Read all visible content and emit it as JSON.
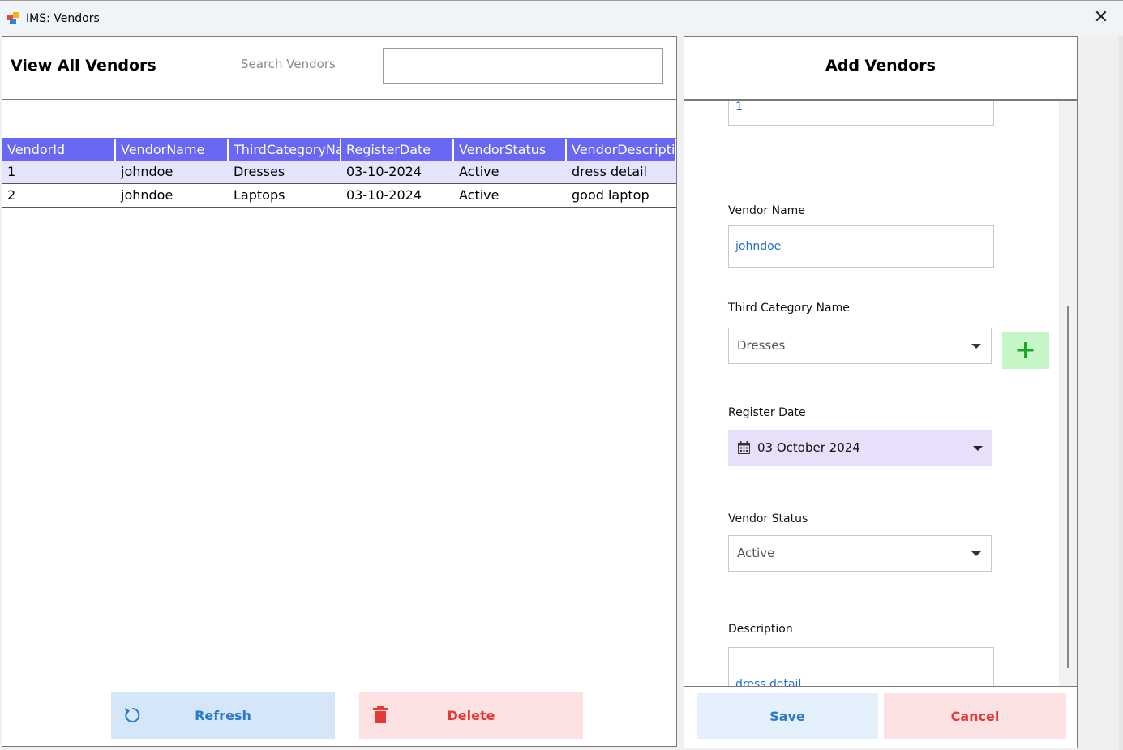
{
  "window": {
    "title": "IMS: Vendors",
    "close_glyph": "✕"
  },
  "left": {
    "title": "View All Vendors",
    "search_label": "Search Vendors",
    "search_value": ""
  },
  "grid": {
    "columns": [
      "VendorId",
      "VendorName",
      "ThirdCategoryNa",
      "RegisterDate",
      "VendorStatus",
      "VendorDescriptic"
    ],
    "rows": [
      [
        "1",
        "johndoe",
        "Dresses",
        "03-10-2024",
        "Active",
        "dress detail"
      ],
      [
        "2",
        "johndoe",
        "Laptops",
        "03-10-2024",
        "Active",
        "good laptop"
      ]
    ],
    "header_color": "#6a67f5",
    "selected_row_color": "#e6e4fc"
  },
  "buttons": {
    "refresh": {
      "label": "Refresh",
      "icon": "refresh-icon"
    },
    "delete": {
      "label": "Delete",
      "icon": "trash-icon"
    },
    "save": {
      "label": "Save"
    },
    "cancel": {
      "label": "Cancel"
    },
    "add_category": {
      "icon": "plus-icon"
    }
  },
  "form": {
    "title": "Add Vendors",
    "vendor_id": "1",
    "vendor_name_label": "Vendor Name",
    "vendor_name": "johndoe",
    "category_label": "Third Category Name",
    "category": "Dresses",
    "date_label": "Register Date",
    "date": "03 October 2024",
    "status_label": "Vendor Status",
    "status": "Active",
    "description_label": "Description",
    "description": "dress detail"
  }
}
